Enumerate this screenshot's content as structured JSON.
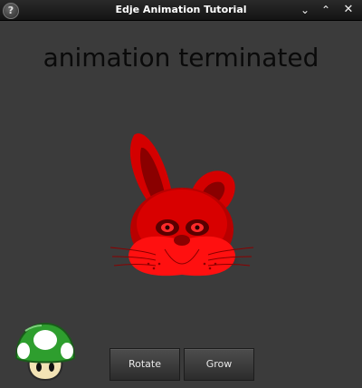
{
  "window": {
    "title": "Edje Animation Tutorial",
    "help_label": "?",
    "minimize_glyph": "⌄",
    "maximize_glyph": "⌃",
    "close_glyph": "✕"
  },
  "main": {
    "status_text": "animation terminated"
  },
  "buttons": {
    "rotate_label": "Rotate",
    "grow_label": "Grow"
  },
  "images": {
    "bunny": "red-bunny-head-icon",
    "mushroom": "green-mushroom-icon"
  },
  "colors": {
    "window_bg": "#3b3b3b",
    "bunny_red": "#ff0000",
    "mushroom_green": "#2e9e2e"
  }
}
